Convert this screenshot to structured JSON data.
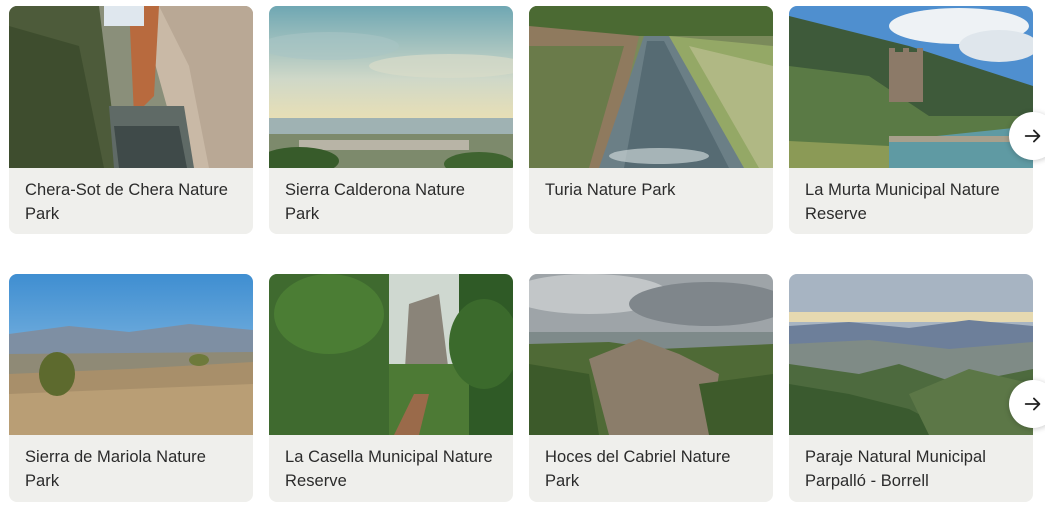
{
  "rows": [
    {
      "cards": [
        {
          "title": "Chera-Sot de Chera Nature Park",
          "image": "canyon-river-photo"
        },
        {
          "title": "Sierra Calderona Nature Park",
          "image": "coastal-view-photo"
        },
        {
          "title": "Turia Nature Park",
          "image": "river-photo"
        },
        {
          "title": "La Murta Municipal Nature Reserve",
          "image": "tower-pool-photo"
        }
      ],
      "next_icon": "arrow-right-icon"
    },
    {
      "cards": [
        {
          "title": "Sierra de Mariola Nature Park",
          "image": "mountain-scrub-photo"
        },
        {
          "title": "La Casella Municipal Nature Reserve",
          "image": "forest-trail-photo"
        },
        {
          "title": "Hoces del Cabriel Nature Park",
          "image": "rocky-gorge-photo"
        },
        {
          "title": "Paraje Natural Municipal Parpalló - Borrell",
          "image": "mountain-valley-photo"
        }
      ],
      "next_icon": "arrow-right-icon"
    }
  ],
  "colors": {
    "card_bg": "#efefec",
    "title_text": "#2b2b2b"
  }
}
